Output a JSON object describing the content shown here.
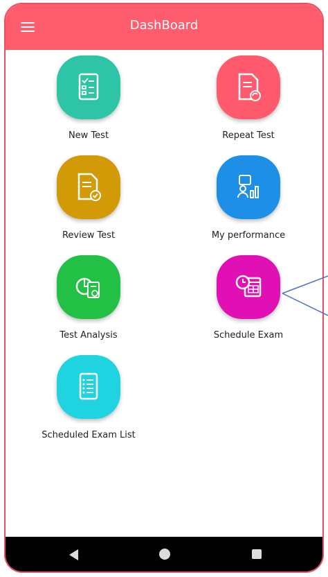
{
  "appbar": {
    "title": "DashBoard"
  },
  "tiles": [
    {
      "label": "New Test",
      "color": "#2ec4a6",
      "icon": "checklist-icon"
    },
    {
      "label": "Repeat Test",
      "color": "#ff5a6e",
      "icon": "document-repeat-icon"
    },
    {
      "label": "Review Test",
      "color": "#d19a06",
      "icon": "document-check-icon"
    },
    {
      "label": "My performance",
      "color": "#1e8fe6",
      "icon": "performance-chart-icon"
    },
    {
      "label": "Test Analysis",
      "color": "#22c044",
      "icon": "pie-chart-report-icon"
    },
    {
      "label": "Schedule Exam",
      "color": "#e010b4",
      "icon": "clock-calendar-icon"
    },
    {
      "label": "Scheduled Exam List",
      "color": "#1fd3e0",
      "icon": "list-document-icon"
    }
  ],
  "colors": {
    "appbar": "#ff5c6e",
    "navbar": "#000000",
    "annotation": "#4a70c4"
  }
}
